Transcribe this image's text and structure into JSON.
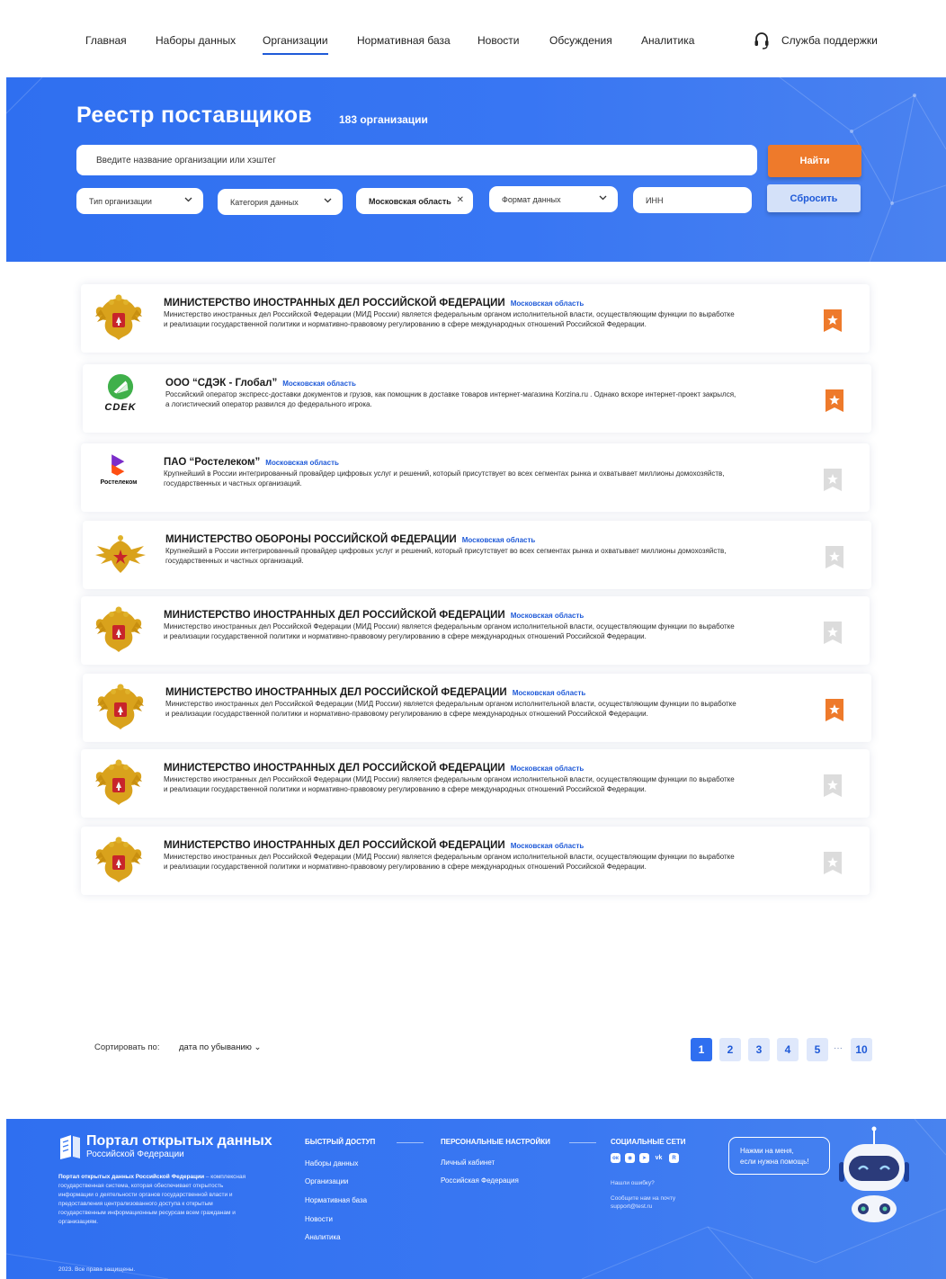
{
  "nav": {
    "items": [
      {
        "label": "Главная",
        "active": false
      },
      {
        "label": "Наборы данных",
        "active": false
      },
      {
        "label": "Организации",
        "active": true
      },
      {
        "label": "Нормативная база",
        "active": false
      },
      {
        "label": "Новости",
        "active": false
      },
      {
        "label": "Обсуждения",
        "active": false
      },
      {
        "label": "Аналитика",
        "active": false
      }
    ],
    "support_label": "Служба поддержки"
  },
  "hero": {
    "title": "Реестр поставщиков",
    "count": "183 организации",
    "search_placeholder": "Введите название организации или хэштег",
    "find_label": "Найти",
    "reset_label": "Сбросить",
    "filters": {
      "org_type": "Тип организации",
      "data_category": "Категория данных",
      "region": "Московская область",
      "data_format": "Формат данных",
      "inn": "ИНН"
    }
  },
  "organizations": [
    {
      "name": "МИНИСТЕРСТВО ИНОСТРАННЫХ ДЕЛ РОССИЙСКОЙ ФЕДЕРАЦИИ",
      "region": "Московская область",
      "description": "Министерство иностранных дел Российской Федерации (МИД России) является федеральным органом исполнительной власти, осуществляющим функции по выработке и реализации государственной политики и нормативно-правовому регулированию в сфере международных отношений Российской Федерации.",
      "logo": "russian-coat-of-arms",
      "favorite": true
    },
    {
      "name": "ООО “СДЭК - Глобал”",
      "region": "Московская область",
      "description": "Российский оператор экспресс-доставки документов и грузов, как помощник в доставке товаров интернет-магазина Korzina.ru . Однако вскоре интернет-проект закрылся, а логистический оператор развился до федерального игрока.",
      "logo": "cdek",
      "logo_text": "CDEK",
      "favorite": true
    },
    {
      "name": "ПАО “Ростелеком”",
      "region": "Московская область",
      "description": "Крупнейший в России интегрированный провайдер цифровых услуг и решений, который присутствует во всех сегментах рынка и охватывает миллионы домохозяйств, государственных и частных организаций.",
      "logo": "rostelecom",
      "logo_text": "Ростелеком",
      "favorite": false
    },
    {
      "name": "МИНИСТЕРСТВО ОБОРОНЫ РОССИЙСКОЙ ФЕДЕРАЦИИ",
      "region": "Московская область",
      "description": "Крупнейший в России интегрированный провайдер цифровых услуг и решений, который присутствует во всех сегментах рынка и охватывает миллионы домохозяйств, государственных и частных организаций.",
      "logo": "defense-emblem",
      "favorite": false
    },
    {
      "name": "МИНИСТЕРСТВО ИНОСТРАННЫХ ДЕЛ РОССИЙСКОЙ ФЕДЕРАЦИИ",
      "region": "Московская область",
      "description": "Министерство иностранных дел Российской Федерации (МИД России) является федеральным органом исполнительной власти, осуществляющим функции по выработке и реализации государственной политики и нормативно-правовому регулированию в сфере международных отношений Российской Федерации.",
      "logo": "russian-coat-of-arms",
      "favorite": false
    },
    {
      "name": "МИНИСТЕРСТВО ИНОСТРАННЫХ ДЕЛ РОССИЙСКОЙ ФЕДЕРАЦИИ",
      "region": "Московская область",
      "description": "Министерство иностранных дел Российской Федерации (МИД России) является федеральным органом исполнительной власти, осуществляющим функции по выработке и реализации государственной политики и нормативно-правовому регулированию в сфере международных отношений Российской Федерации.",
      "logo": "russian-coat-of-arms",
      "favorite": true
    },
    {
      "name": "МИНИСТЕРСТВО ИНОСТРАННЫХ ДЕЛ РОССИЙСКОЙ ФЕДЕРАЦИИ",
      "region": "Московская область",
      "description": "Министерство иностранных дел Российской Федерации (МИД России) является федеральным органом исполнительной власти, осуществляющим функции по выработке и реализации государственной политики и нормативно-правовому регулированию в сфере международных отношений Российской Федерации.",
      "logo": "russian-coat-of-arms",
      "favorite": false
    },
    {
      "name": "МИНИСТЕРСТВО ИНОСТРАННЫХ ДЕЛ РОССИЙСКОЙ ФЕДЕРАЦИИ",
      "region": "Московская область",
      "description": "Министерство иностранных дел Российской Федерации (МИД России) является федеральным органом исполнительной власти, осуществляющим функции по выработке и реализации государственной политики и нормативно-правовому регулированию в сфере международных отношений Российской Федерации.",
      "logo": "russian-coat-of-arms",
      "favorite": false
    }
  ],
  "sort": {
    "label": "Сортировать по:",
    "value": "дата по убыванию"
  },
  "pagination": {
    "pages": [
      "1",
      "2",
      "3",
      "4",
      "5"
    ],
    "ellipsis": "···",
    "last": "10",
    "current": "1"
  },
  "footer": {
    "logo_title": "Портал открытых данных",
    "logo_subtitle": "Российской Федерации",
    "about_bold": "Портал открытых данных Российской Федерации",
    "about_text": " – комплексная государственная система, которая обеспечивает открытость информации о деятельности органов государственной власти и предоставления централизованного доступа к открытым государственным информационным ресурсам всем гражданам и организациям.",
    "quick_access": {
      "title": "БЫСТРЫЙ ДОСТУП",
      "links": [
        "Наборы данных",
        "Организации",
        "Нормативная база",
        "Новости",
        "Аналитика"
      ]
    },
    "personal": {
      "title": "ПЕРСОНАЛЬНЫЕ НАСТРОЙКИ",
      "links": [
        "Личный кабинет",
        "Российская Федерация"
      ]
    },
    "social": {
      "title": "СОЦИАЛЬНЫЕ СЕТИ",
      "icons": [
        "odnoklassniki-icon",
        "messenger-icon",
        "telegram-icon",
        "vk-icon",
        "rutube-icon"
      ],
      "error_q": "Нашли ошибку?",
      "error_hint": "Сообщите нам на почту",
      "email": "support@test.ru"
    },
    "bubble_line1": "Нажми на меня,",
    "bubble_line2": "если нужна помощь!",
    "copyright": "2023. Все права защищены."
  },
  "colors": {
    "primary": "#2f6ff0",
    "accent_orange": "#ee7a2b",
    "favorite_active": "#ee7a2b",
    "favorite_inactive": "#dcdcdc"
  }
}
